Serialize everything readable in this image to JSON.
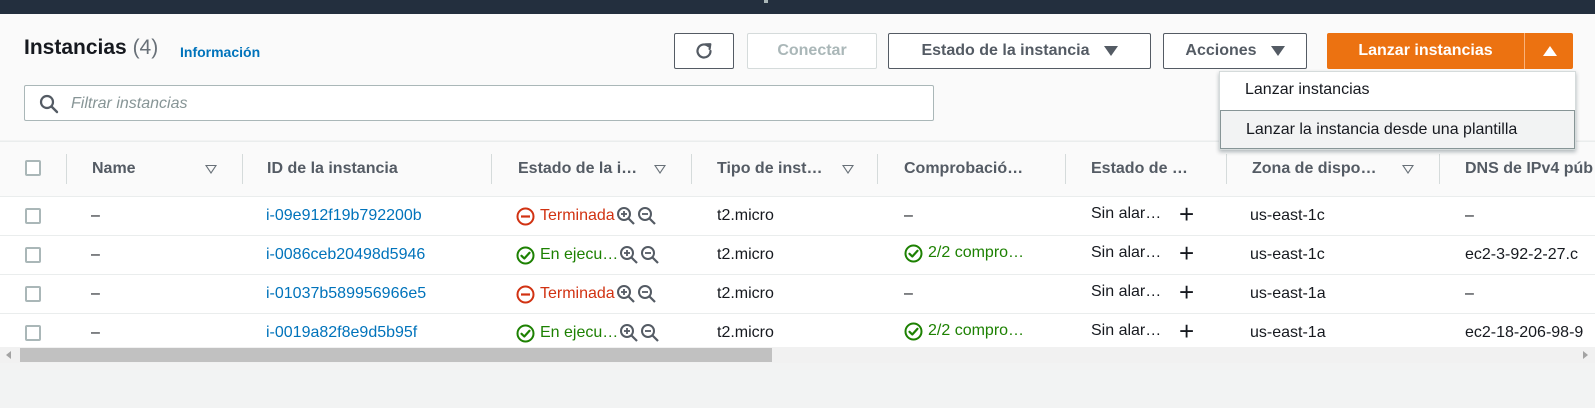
{
  "header": {
    "title": "Instancias",
    "count": "(4)",
    "info_link": "Información"
  },
  "toolbar": {
    "connect_label": "Conectar",
    "state_label": "Estado de la instancia",
    "actions_label": "Acciones",
    "launch_label": "Lanzar instancias"
  },
  "launch_menu": {
    "items": [
      "Lanzar instancias",
      "Lanzar la instancia desde una plantilla"
    ]
  },
  "search": {
    "placeholder": "Filtrar instancias"
  },
  "table": {
    "columns": [
      "Name",
      "ID de la instancia",
      "Estado de la i…",
      "Tipo de inst…",
      "Comprobació…",
      "Estado de …",
      "Zona de dispo…",
      "DNS de IPv4 púb"
    ],
    "rows": [
      {
        "name": "–",
        "id": "i-09e912f19b792200b",
        "state": "Terminada",
        "state_kind": "terminated",
        "type": "t2.micro",
        "check": "–",
        "alarm": "Sin alar…",
        "zone": "us-east-1c",
        "dns": "–"
      },
      {
        "name": "–",
        "id": "i-0086ceb20498d5946",
        "state": "En ejecu…",
        "state_kind": "running",
        "type": "t2.micro",
        "check": "2/2 compro…",
        "alarm": "Sin alar…",
        "zone": "us-east-1c",
        "dns": "ec2-3-92-2-27.c"
      },
      {
        "name": "–",
        "id": "i-01037b589956966e5",
        "state": "Terminada",
        "state_kind": "terminated",
        "type": "t2.micro",
        "check": "–",
        "alarm": "Sin alar…",
        "zone": "us-east-1a",
        "dns": "–"
      },
      {
        "name": "–",
        "id": "i-0019a82f8e9d5b95f",
        "state": "En ejecu…",
        "state_kind": "running",
        "type": "t2.micro",
        "check": "2/2 compro…",
        "alarm": "Sin alar…",
        "zone": "us-east-1a",
        "dns": "ec2-18-206-98-9"
      }
    ]
  },
  "colors": {
    "accent_orange": "#ec7211",
    "link_blue": "#0073bb",
    "running_green": "#1d8102",
    "terminated_red": "#d13212",
    "topbar": "#232f3e"
  },
  "icons": [
    "refresh-icon",
    "caret-down-icon",
    "caret-up-icon",
    "search-icon",
    "zoom-in-icon",
    "zoom-out-icon",
    "check-circle-icon",
    "minus-circle-icon",
    "plus-icon",
    "sort-icon"
  ]
}
